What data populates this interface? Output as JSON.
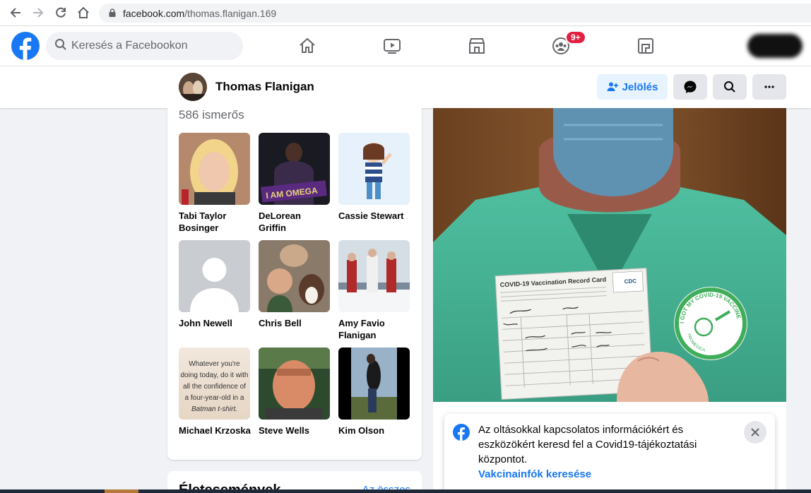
{
  "browser": {
    "url_domain": "facebook.com",
    "url_path": "/thomas.flanigan.169"
  },
  "header": {
    "search_placeholder": "Keresés a Facebookon",
    "groups_badge": "9+",
    "brand_color": "#1877f2"
  },
  "profile": {
    "name": "Thomas Flanigan",
    "tag_button": "Jelölés"
  },
  "friends": {
    "count_label": "586 ismerős",
    "items": [
      {
        "name": "Tabi Taylor Bosinger"
      },
      {
        "name": "DeLorean Griffin",
        "photo_text": "I AM OMEGA"
      },
      {
        "name": "Cassie Stewart"
      },
      {
        "name": "John Newell"
      },
      {
        "name": "Chris Bell"
      },
      {
        "name": "Amy Favio Flanigan"
      },
      {
        "name": "Michael Krzoska",
        "photo_text_lines": [
          "Whatever you're",
          "doing today, do it with",
          "all the confidence of",
          "a four-year-old in a",
          "Batman t-shirt."
        ]
      },
      {
        "name": "Steve Wells"
      },
      {
        "name": "Kim Olson"
      }
    ]
  },
  "life_events": {
    "title": "Életesemények",
    "see_all": "Az összes"
  },
  "post_photo": {
    "card_title": "COVID-19 Vaccination Record Card",
    "cdc_label": "CDC",
    "sticker_text": "I GOT MY COVID-19 VACCINE",
    "sticker_sub": "PROMEDICA"
  },
  "covid_notice": {
    "text": "Az oltásokkal kapcsolatos információkért és eszközökért keresd fel a Covid19-tájékoztatási központot.",
    "link": "Vakcinainfók keresése"
  }
}
